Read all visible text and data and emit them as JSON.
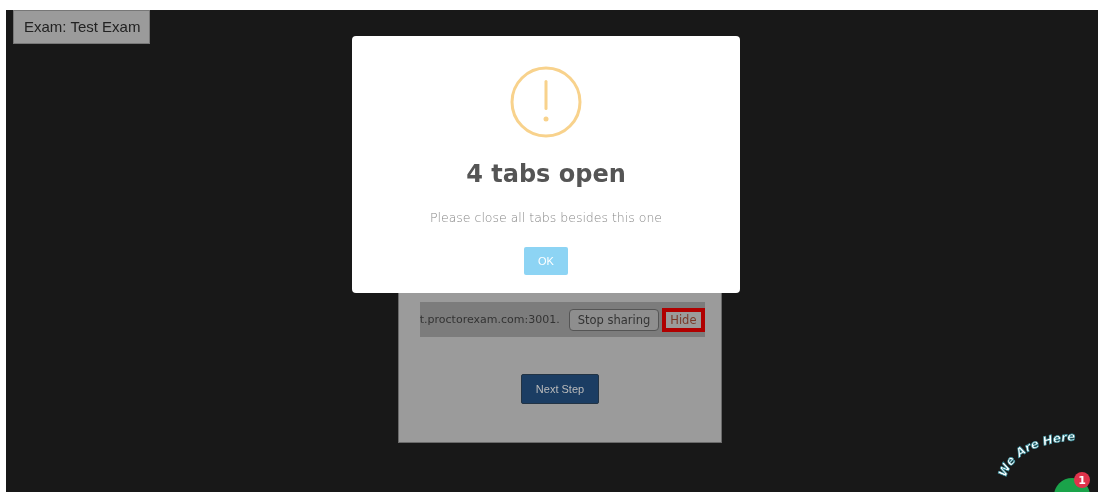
{
  "exam_label": "Exam: Test Exam",
  "background_page": {
    "share_bar": {
      "url_text": "t.proctorexam.com:3001.",
      "stop_button": "Stop sharing",
      "hide_button": "Hide"
    },
    "next_button": "Next Step"
  },
  "dialog": {
    "title": "4 tabs open",
    "message": "Please close all tabs besides this one",
    "button": "OK"
  },
  "chat_widget": {
    "label": "We Are Here",
    "badge": "1"
  }
}
